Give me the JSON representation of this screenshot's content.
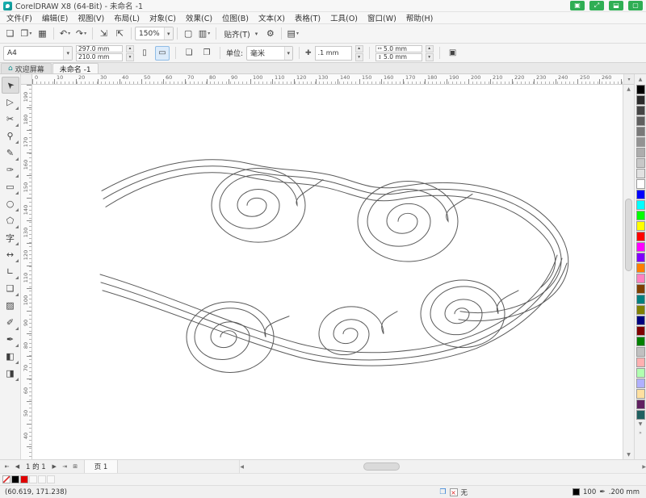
{
  "window": {
    "title": "CorelDRAW X8 (64-Bit) - 未命名 -1",
    "overlay_buttons": [
      {
        "name": "overlay-screen-button",
        "glyph": "▣"
      },
      {
        "name": "overlay-expand-button",
        "glyph": "⤢"
      },
      {
        "name": "overlay-save-button",
        "glyph": "⬓"
      },
      {
        "name": "overlay-window-button",
        "glyph": "▢"
      }
    ]
  },
  "menu": {
    "items": [
      {
        "key": "file",
        "label": "文件(F)"
      },
      {
        "key": "edit",
        "label": "编辑(E)"
      },
      {
        "key": "view",
        "label": "视图(V)"
      },
      {
        "key": "layout",
        "label": "布局(L)"
      },
      {
        "key": "object",
        "label": "对象(C)"
      },
      {
        "key": "effects",
        "label": "效果(C)"
      },
      {
        "key": "bitmaps",
        "label": "位图(B)"
      },
      {
        "key": "text",
        "label": "文本(X)"
      },
      {
        "key": "table",
        "label": "表格(T)"
      },
      {
        "key": "tools",
        "label": "工具(O)"
      },
      {
        "key": "window",
        "label": "窗口(W)"
      },
      {
        "key": "help",
        "label": "帮助(H)"
      }
    ]
  },
  "toolbar": {
    "items": [
      {
        "t": "btn",
        "name": "new-document-button",
        "g": "❏"
      },
      {
        "t": "btn",
        "name": "open-button",
        "g": "❐",
        "dd": true
      },
      {
        "t": "btn",
        "name": "save-button",
        "g": "▦"
      },
      {
        "t": "sep"
      },
      {
        "t": "btn",
        "name": "undo-button",
        "g": "↶",
        "dd": true
      },
      {
        "t": "btn",
        "name": "redo-button",
        "g": "↷",
        "dd": true
      },
      {
        "t": "sep"
      },
      {
        "t": "btn",
        "name": "import-button",
        "g": "⇲"
      },
      {
        "t": "btn",
        "name": "export-button",
        "g": "⇱"
      },
      {
        "t": "sep"
      },
      {
        "t": "combo",
        "name": "zoom-level-select",
        "value": "150%"
      },
      {
        "t": "sep"
      },
      {
        "t": "btn",
        "name": "full-screen-preview-button",
        "g": "▢"
      },
      {
        "t": "btn",
        "name": "view-layout-button",
        "g": "▥",
        "dd": true
      },
      {
        "t": "sep"
      },
      {
        "t": "drop",
        "name": "snap-to-menu",
        "label": "贴齐(T)"
      },
      {
        "t": "btn",
        "name": "options-button",
        "g": "⚙"
      },
      {
        "t": "sep"
      },
      {
        "t": "btn",
        "name": "dockers-button",
        "g": "▤",
        "dd": true
      }
    ]
  },
  "property_bar": {
    "page_size": "A4",
    "page_width": "297.0 mm",
    "page_height": "210.0 mm",
    "units_label": "单位:",
    "units_value": "毫米",
    "nudge_value": ".1 mm",
    "duplicate_x": "5.0 mm",
    "duplicate_y": "5.0 mm"
  },
  "tabs": {
    "welcome": "欢迎屏幕",
    "document": "未命名 -1"
  },
  "toolbox": {
    "tools": [
      {
        "name": "pick-tool",
        "glyph": "➤",
        "active": true,
        "rot": true
      },
      {
        "name": "shape-tool",
        "glyph": "▷",
        "fly": true
      },
      {
        "name": "crop-tool",
        "glyph": "✂",
        "fly": true
      },
      {
        "name": "zoom-tool",
        "glyph": "⚲",
        "fly": true
      },
      {
        "name": "freehand-tool",
        "glyph": "✎",
        "fly": true
      },
      {
        "name": "artistic-media-tool",
        "glyph": "✑",
        "fly": true
      },
      {
        "name": "rectangle-tool",
        "glyph": "▭",
        "fly": true
      },
      {
        "name": "ellipse-tool",
        "glyph": "○",
        "fly": true
      },
      {
        "name": "polygon-tool",
        "glyph": "⬠",
        "fly": true
      },
      {
        "name": "text-tool",
        "glyph": "字",
        "fly": true
      },
      {
        "name": "parallel-dimension-tool",
        "glyph": "↔",
        "fly": true
      },
      {
        "name": "connector-tool",
        "glyph": "∟",
        "fly": true
      },
      {
        "name": "drop-shadow-tool",
        "glyph": "❑",
        "fly": true
      },
      {
        "name": "transparency-tool",
        "glyph": "▨"
      },
      {
        "name": "color-eyedropper-tool",
        "glyph": "✐",
        "fly": true
      },
      {
        "name": "outline-pen-tool",
        "glyph": "✒",
        "fly": true
      },
      {
        "name": "fill-tool",
        "glyph": "◧",
        "fly": true
      },
      {
        "name": "interactive-fill-tool",
        "glyph": "◨",
        "fly": true
      }
    ]
  },
  "rulers": {
    "h_labels": [
      "0",
      "10",
      "20",
      "30",
      "40",
      "50",
      "60",
      "70",
      "80",
      "90",
      "100",
      "110",
      "120",
      "130",
      "140",
      "150",
      "160",
      "170",
      "180",
      "190",
      "200",
      "210",
      "220",
      "230",
      "240",
      "250",
      "260"
    ],
    "v_labels": [
      "190",
      "180",
      "170",
      "160",
      "150",
      "140",
      "130",
      "120",
      "110",
      "100",
      "90",
      "80",
      "70",
      "60",
      "50",
      "40"
    ]
  },
  "palette": {
    "colors": [
      "#000000",
      "#2b2b2b",
      "#454545",
      "#5f5f5f",
      "#797979",
      "#939393",
      "#adadad",
      "#c7c7c7",
      "#e1e1e1",
      "#ffffff",
      "#0000ff",
      "#00ffff",
      "#00ff00",
      "#ffff00",
      "#ff0000",
      "#ff00ff",
      "#8000ff",
      "#ff7f00",
      "#ff80c0",
      "#804000",
      "#008080",
      "#808000",
      "#000080",
      "#800000",
      "#008000",
      "#c0c0c0",
      "#ffb0b0",
      "#b0ffb0",
      "#b0b0ff",
      "#ffe0a0",
      "#602060",
      "#206060"
    ]
  },
  "canvas": {
    "stroke": "#5a5a5a",
    "paths": [
      "M 86 132 C 150 96 215 86 268 98 C 310 108 330 104 368 112 C 404 120 418 134 462 126 C 520 116 585 124 628 158 C 668 190 676 232 644 262 C 616 288 566 298 528 292",
      "M 88 142 C 152 104 214 94 266 106 C 308 116 330 112 366 120 C 402 128 418 142 460 134 C 518 124 580 132 622 164 C 660 194 666 230 636 256 C 610 278 566 288 530 282",
      "M 91 152 C 154 112 213 102 264 114 C 306 124 328 120 364 128 C 400 136 418 150 458 142 C 514 132 576 140 616 172 C 652 200 658 228 630 252",
      "M 84 236 C 170 262 250 300 330 322 C 400 340 480 336 545 312 C 600 290 638 254 650 212",
      "M 85 246 C 172 272 252 310 332 332 C 402 350 482 344 548 320 C 604 296 644 258 656 216",
      "M 87 256 C 174 282 254 318 334 340 C 404 356 484 352 550 328 C 606 304 648 264 662 222",
      "M 360 118 C 342 132 322 140 328 150 A 48 38 0 0 0 232 150 A 37 29 0 0 0 306 150 A 26 20 0 0 0 254 150 A 18 14 0 0 0 290 150 A 12 9 0 0 0 266 150",
      "M 338 150 A 58 46 0 1 0 222 150 A 58 46 0 1 0 338 150",
      "M 545 136 C 528 148 505 156 515 170 A 50 40 0 0 0 415 170 A 39 31 0 0 0 493 170 A 27 22 0 0 0 439 170 A 19 15 0 0 0 477 170 A 12 10 0 0 0 453 170",
      "M 527 170 A 62 50 0 1 0 403 170 A 62 50 0 1 0 527 170",
      "M 318 288 C 300 295 283 300 289 314 A 44 36 0 0 0 201 314 A 34 28 0 0 0 269 314 A 24 19 0 0 0 221 314 A 16 13 0 0 0 253 314 A 10 8 0 0 0 233 314",
      "M 299 314 A 54 44 0 1 0 191 314 A 54 44 0 1 0 299 314",
      "M 452 282 C 437 290 428 296 435 310 A 40 34 0 0 0 355 310 A 31 26 0 0 0 417 310 A 22 18 0 0 0 373 310 A 15 12 0 0 0 403 310 A 9 7 0 0 0 385 310",
      "M 602 256 C 587 264 570 270 577 285 A 42 34 0 0 0 493 285 A 32 26 0 0 0 557 285 A 23 18 0 0 0 511 285 A 15 12 0 0 0 541 285 A 9 7 0 0 0 523 285",
      "M 585 285 A 52 42 0 1 0 481 285 A 52 42 0 1 0 585 285"
    ]
  },
  "page_nav": {
    "indicator": "1 的 1",
    "page_tab": "页 1"
  },
  "status": {
    "coords": "(60.619, 171.238)",
    "fill_label": "无",
    "fill_value": "100",
    "outline_value": ".200 mm",
    "doc_palette": [
      "#000000",
      "#e00000"
    ]
  },
  "icons": {
    "dropdown": "▾",
    "stepper-up": "▴",
    "stepper-down": "▾",
    "portrait": "▯",
    "landscape": "▭",
    "page-all": "❏",
    "page-current": "❐",
    "nudge": "✚",
    "dup-x": "↔",
    "dup-y": "↕",
    "treat-filled": "▣",
    "home": "⌂",
    "scroll-up": "▲",
    "scroll-down": "▼",
    "scroll-left": "◀",
    "scroll-right": "▶",
    "nav-first": "⇤",
    "nav-prev": "◀",
    "nav-next": "▶",
    "nav-last": "⇥",
    "add-page": "⊞",
    "expand": "»",
    "pages": "❒",
    "no-fill": "×",
    "pen": "✒"
  }
}
